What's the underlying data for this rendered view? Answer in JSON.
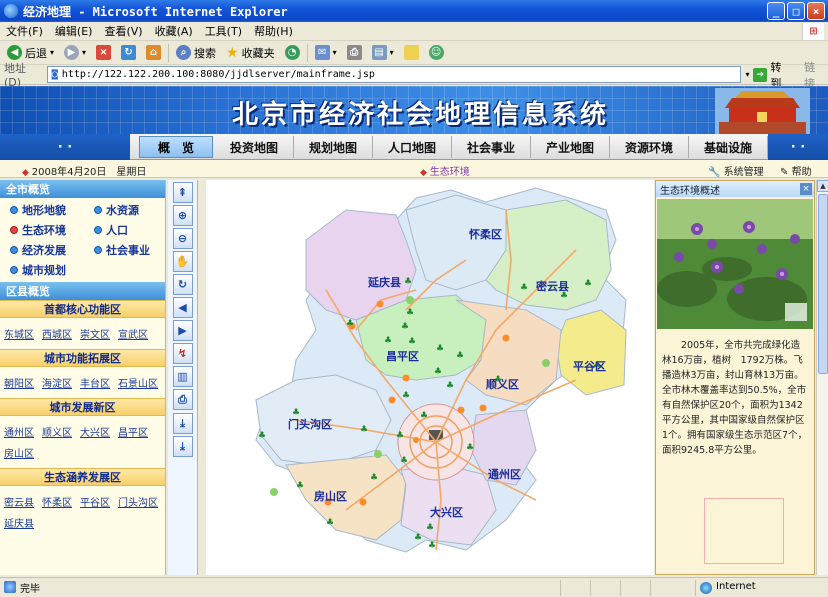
{
  "window": {
    "title": "经济地理 - Microsoft Internet Explorer"
  },
  "menu": [
    "文件(F)",
    "编辑(E)",
    "查看(V)",
    "收藏(A)",
    "工具(T)",
    "帮助(H)"
  ],
  "toolbar": {
    "back": "后退",
    "search": "搜索",
    "favorites": "收藏夹"
  },
  "address": {
    "label": "地址(D)",
    "url": "http://122.122.200.100:8080/jjdlserver/mainframe.jsp",
    "go": "转到",
    "links": "链接"
  },
  "banner": {
    "title": "北京市经济社会地理信息系统"
  },
  "nav": {
    "tabs": [
      "概　览",
      "投资地图",
      "规划地图",
      "人口地图",
      "社会事业",
      "产业地图",
      "资源环境",
      "基础设施"
    ],
    "active": 0
  },
  "datebar": {
    "date": "2008年4月20日　星期日",
    "current": "生态环境",
    "system": "系统管理",
    "help": "帮助"
  },
  "left": {
    "overview_title": "全市概览",
    "overview_items": [
      "地形地貌",
      "水资源",
      "生态环境",
      "人口",
      "经济发展",
      "社会事业",
      "城市规划"
    ],
    "district_title": "区县概览",
    "groups": [
      {
        "name": "首都核心功能区",
        "items": [
          "东城区",
          "西城区",
          "崇文区",
          "宣武区"
        ]
      },
      {
        "name": "城市功能拓展区",
        "items": [
          "朝阳区",
          "海淀区",
          "丰台区",
          "石景山区"
        ]
      },
      {
        "name": "城市发展新区",
        "items": [
          "通州区",
          "顺义区",
          "大兴区",
          "昌平区",
          "房山区"
        ]
      },
      {
        "name": "生态涵养发展区",
        "items": [
          "密云县",
          "怀柔区",
          "平谷区",
          "门头沟区",
          "延庆县"
        ]
      }
    ]
  },
  "tools": [
    "zoom-full",
    "zoom-in",
    "zoom-out",
    "pan",
    "refresh",
    "back",
    "forward",
    "identify",
    "measure",
    "print",
    "download",
    "export"
  ],
  "map": {
    "districts": [
      "怀柔区",
      "延庆县",
      "密云县",
      "昌平区",
      "平谷区",
      "顺义区",
      "门头沟区",
      "通州区",
      "房山区",
      "大兴区"
    ],
    "colors": {
      "huairou": "#dbeaf6",
      "yanqing": "#e6d2ee",
      "miyun": "#d8f0c8",
      "changping": "#c8f0c0",
      "pinggu": "#f5ee8e",
      "shunyi": "#f6dcc0",
      "mentougou": "#dce8f6",
      "tongzhou": "#e4d8f0",
      "fangshan": "#f6e2c4",
      "daxing": "#ede0f2",
      "core": "#f7e6e6",
      "roads": "#f5a560"
    }
  },
  "right": {
    "title": "生态环境概述",
    "text": "2005年，全市共完成绿化造林16万亩，植树　1792万株。飞播造林3万亩，封山育林13万亩。全市林木覆盖率达到50.5%，全市有自然保护区20个，面积为1342平方公里，其中国家级自然保护区1个。拥有国家级生态示范区7个，面积9245.8平方公里。"
  },
  "status": {
    "text": "完毕",
    "zone": "Internet"
  }
}
